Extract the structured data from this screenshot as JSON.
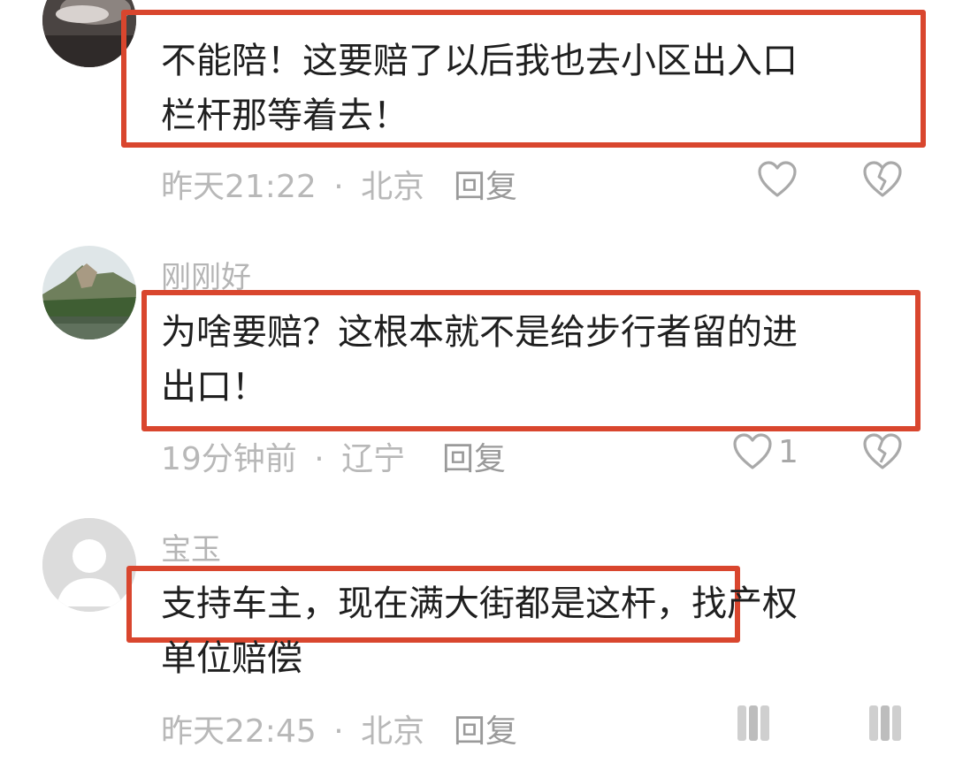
{
  "comments": [
    {
      "username": "",
      "text_lines": [
        "不能陪！这要赔了以后我也去小区出入口",
        "栏杆那等着去！"
      ],
      "time": "昨天21:22",
      "location": "北京",
      "meta_sep": "·",
      "reply_label": "回复",
      "like_count": "",
      "avatar_icon": "user-photo-avatar"
    },
    {
      "username": "刚刚好",
      "text_lines": [
        "为啥要赔？这根本就不是给步行者留的进",
        "出口！"
      ],
      "time": "19分钟前",
      "location": "辽宁",
      "meta_sep": "·",
      "reply_label": "回复",
      "like_count": "1",
      "avatar_icon": "landscape-photo-avatar"
    },
    {
      "username": "宝玉",
      "text_lines": [
        "支持车主，现在满大街都是这杆，找产权",
        "单位赔偿"
      ],
      "time": "昨天22:45",
      "location": "北京",
      "meta_sep": "·",
      "reply_label": "回复",
      "like_count": "",
      "avatar_icon": "default-user-avatar"
    }
  ],
  "icons": {
    "like": "heart-outline-icon",
    "dislike": "broken-heart-icon",
    "loading": "placeholder-bars-icon"
  },
  "colors": {
    "highlight_box": "#d9462e",
    "meta_text": "#b8b8b8",
    "icon_stroke": "#a9a9a9"
  }
}
